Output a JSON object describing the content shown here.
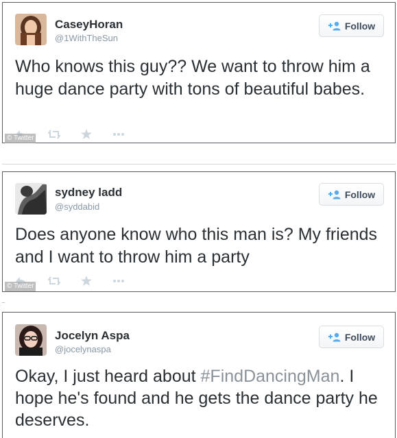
{
  "tweets": [
    {
      "name": "CaseyHoran",
      "handle": "@1WithTheSun",
      "text": "Who knows this guy?? We want to throw him a huge dance party with tons of beautiful babes.",
      "follow_label": "Follow",
      "watermark": "© Twitter"
    },
    {
      "name": "sydney ladd",
      "handle": "@syddabid",
      "text": "Does anyone know who this man is? My friends and I want to throw him a party",
      "follow_label": "Follow",
      "watermark": "© Twitter"
    },
    {
      "name": "Jocelyn Aspa",
      "handle": "@jocelynaspa",
      "text_before": "Okay, I just heard about ",
      "hashtag": "#FindDancingMan",
      "text_after": ". I hope he's found and he gets the dance party he deserves.",
      "follow_label": "Follow"
    }
  ],
  "icons": {
    "follow": "add-user-icon",
    "reply": "reply-icon",
    "retweet": "retweet-icon",
    "favorite": "star-icon",
    "more": "more-icon"
  },
  "colors": {
    "name_text": "#292f33",
    "handle_text": "#8899a6",
    "follow_icon": "#55acee",
    "action_icon": "#ccd6dd",
    "hashtag": "#8a9299",
    "card_border": "#555b61"
  }
}
